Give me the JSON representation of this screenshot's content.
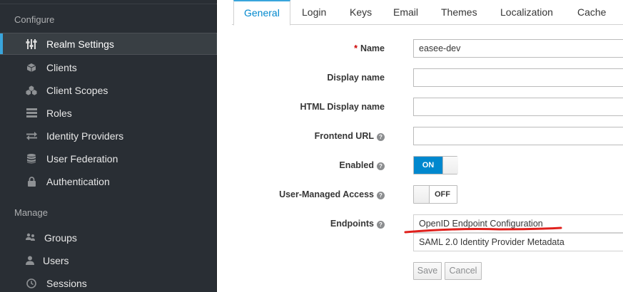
{
  "sidebar": {
    "configure_title": "Configure",
    "manage_title": "Manage",
    "configure_items": [
      {
        "label": "Realm Settings",
        "icon": "sliders-icon",
        "active": true
      },
      {
        "label": "Clients",
        "icon": "cube-icon"
      },
      {
        "label": "Client Scopes",
        "icon": "cubes-icon"
      },
      {
        "label": "Roles",
        "icon": "list-icon"
      },
      {
        "label": "Identity Providers",
        "icon": "exchange-icon"
      },
      {
        "label": "User Federation",
        "icon": "database-icon"
      },
      {
        "label": "Authentication",
        "icon": "lock-icon"
      }
    ],
    "manage_items": [
      {
        "label": "Groups",
        "icon": "users-icon"
      },
      {
        "label": "Users",
        "icon": "user-icon"
      },
      {
        "label": "Sessions",
        "icon": "clock-icon"
      }
    ]
  },
  "tabs": [
    "General",
    "Login",
    "Keys",
    "Email",
    "Themes",
    "Localization",
    "Cache"
  ],
  "form": {
    "name_label": "Name",
    "name_required": "*",
    "name_value": "easee-dev",
    "display_name_label": "Display name",
    "display_name_value": "",
    "html_display_name_label": "HTML Display name",
    "html_display_name_value": "",
    "frontend_url_label": "Frontend URL",
    "frontend_url_value": "",
    "enabled_label": "Enabled",
    "enabled_state": "ON",
    "user_managed_access_label": "User-Managed Access",
    "user_managed_access_state": "OFF",
    "endpoints_label": "Endpoints",
    "endpoints": [
      "OpenID Endpoint Configuration",
      "SAML 2.0 Identity Provider Metadata"
    ],
    "save_label": "Save",
    "cancel_label": "Cancel"
  },
  "colors": {
    "accent": "#0088ce",
    "sidebar_bg": "#292e34",
    "annotation": "#e0201c"
  }
}
